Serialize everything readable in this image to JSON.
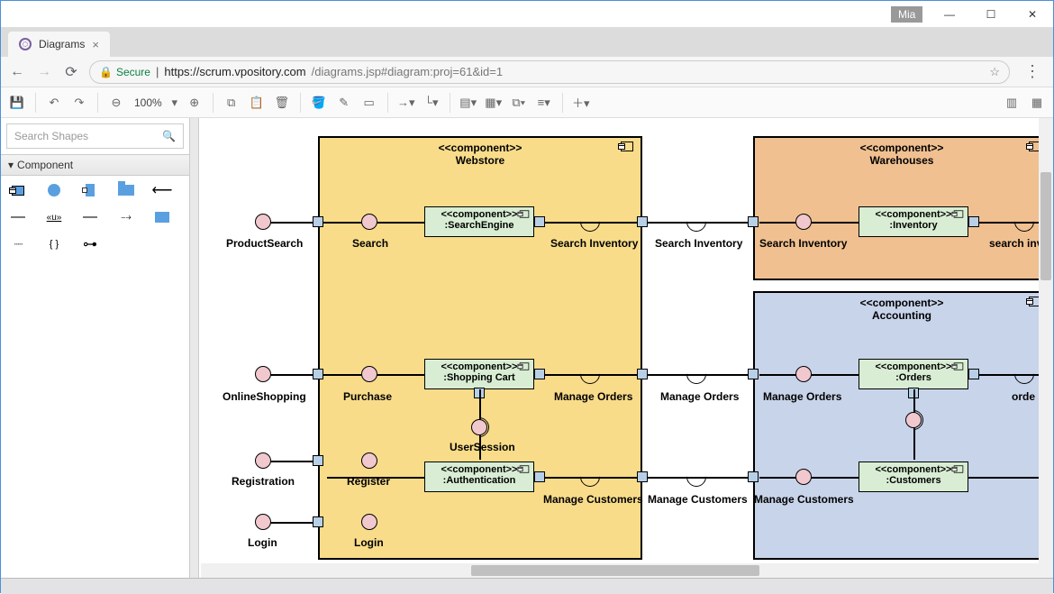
{
  "window": {
    "user": "Mia"
  },
  "browser": {
    "tab_title": "Diagrams",
    "secure_label": "Secure",
    "url_host": "https://scrum.vpository.com",
    "url_path": "/diagrams.jsp#diagram:proj=61&id=1"
  },
  "toolbar": {
    "zoom": "100%"
  },
  "sidebar": {
    "search_placeholder": "Search Shapes",
    "palette_header": "Component"
  },
  "diagram": {
    "stereotype": "<<component>>",
    "containers": {
      "webstore": "Webstore",
      "warehouses": "Warehouses",
      "accounting": "Accounting"
    },
    "components": {
      "search_engine": ":SearchEngine",
      "inventory": ":Inventory",
      "shopping_cart": ":Shopping Cart",
      "orders": ":Orders",
      "authentication": ":Authentication",
      "customers": ":Customers"
    },
    "labels": {
      "product_search": "ProductSearch",
      "search": "Search",
      "search_inventory": "Search Inventory",
      "search_inv": "search inv",
      "online_shopping": "OnlineShopping",
      "purchase": "Purchase",
      "manage_orders": "Manage Orders",
      "orders": "orde",
      "registration": "Registration",
      "register": "Register",
      "login": "Login",
      "user_session": "UserSession",
      "manage_customers": "Manage Customers"
    }
  }
}
